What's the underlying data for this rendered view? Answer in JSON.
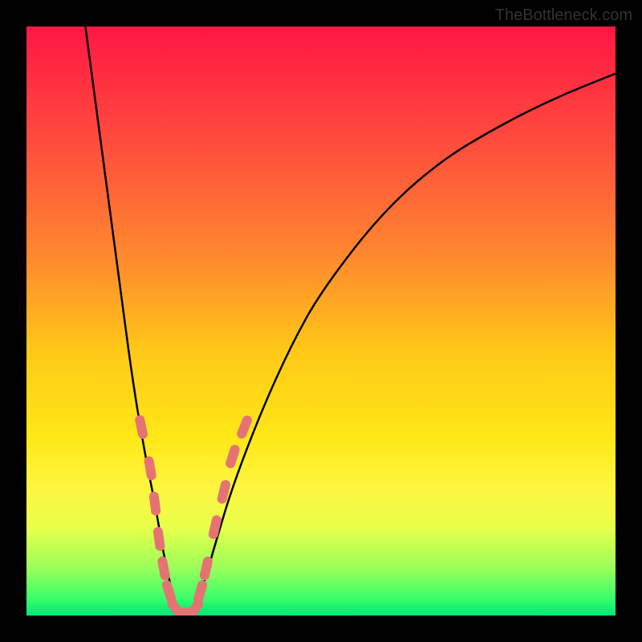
{
  "watermark": "TheBottleneck.com",
  "chart_data": {
    "type": "line",
    "title": "",
    "xlabel": "",
    "ylabel": "",
    "xlim": [
      0,
      100
    ],
    "ylim": [
      0,
      100
    ],
    "background_gradient": {
      "stops": [
        {
          "offset": 0,
          "color": "#ff1744"
        },
        {
          "offset": 20,
          "color": "#ff4d3d"
        },
        {
          "offset": 40,
          "color": "#ff8c2e"
        },
        {
          "offset": 55,
          "color": "#ffc817"
        },
        {
          "offset": 70,
          "color": "#ffe817"
        },
        {
          "offset": 78,
          "color": "#fff53f"
        },
        {
          "offset": 85,
          "color": "#e8ff4a"
        },
        {
          "offset": 92,
          "color": "#9aff5a"
        },
        {
          "offset": 97,
          "color": "#3aff6a"
        },
        {
          "offset": 100,
          "color": "#00e676"
        }
      ]
    },
    "series": [
      {
        "name": "left-curve",
        "x": [
          10,
          12,
          14,
          16,
          18,
          20,
          22,
          23,
          24,
          25,
          26
        ],
        "y": [
          100,
          85,
          70,
          55,
          40,
          28,
          18,
          12,
          7,
          3,
          0
        ]
      },
      {
        "name": "right-curve",
        "x": [
          28,
          30,
          32,
          35,
          40,
          45,
          50,
          60,
          70,
          80,
          90,
          100
        ],
        "y": [
          0,
          5,
          12,
          22,
          35,
          46,
          55,
          68,
          77,
          83,
          88,
          92
        ]
      }
    ],
    "highlight_dots": {
      "color": "#e57373",
      "radius": 6,
      "points": [
        {
          "x": 19.5,
          "y": 32
        },
        {
          "x": 21,
          "y": 25
        },
        {
          "x": 21.8,
          "y": 19
        },
        {
          "x": 22.5,
          "y": 13
        },
        {
          "x": 23.3,
          "y": 8
        },
        {
          "x": 24.2,
          "y": 4
        },
        {
          "x": 25.5,
          "y": 1
        },
        {
          "x": 27,
          "y": 0.5
        },
        {
          "x": 28.5,
          "y": 1
        },
        {
          "x": 29.5,
          "y": 4
        },
        {
          "x": 30.5,
          "y": 8
        },
        {
          "x": 32,
          "y": 15
        },
        {
          "x": 33.5,
          "y": 21
        },
        {
          "x": 35,
          "y": 27
        },
        {
          "x": 37,
          "y": 32
        }
      ]
    }
  }
}
